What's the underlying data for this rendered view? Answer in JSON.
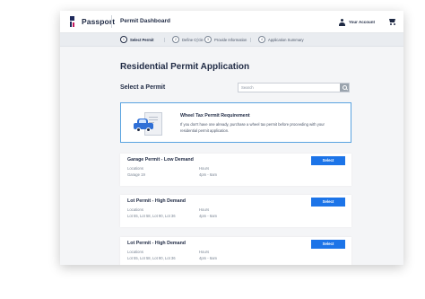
{
  "header": {
    "brand": "Passport",
    "title": "Permit Dashboard",
    "account_label": "Your Account"
  },
  "steps": [
    {
      "num": "1",
      "label": "Select Permit",
      "active": true
    },
    {
      "num": "2",
      "label": "Define Cycle",
      "active": false
    },
    {
      "num": "3",
      "label": "Provide Information",
      "active": false
    },
    {
      "num": "4",
      "label": "Application Summary",
      "active": false
    }
  ],
  "main": {
    "page_title": "Residential Permit Application",
    "section_title": "Select a Permit",
    "search_placeholder": "Search"
  },
  "info_box": {
    "title": "Wheel Tax Permit Requirement",
    "description": "If you don't have one already, purchase a wheel tax permit before proceeding with your residential permit application."
  },
  "permits": [
    {
      "title": "Garage Permit - Low Demand",
      "locations_label": "Locations",
      "locations": "Garage 19",
      "hours_label": "Hours",
      "hours": "4pm - 6am",
      "button": "Select"
    },
    {
      "title": "Lot Permit - High Demand",
      "locations_label": "Locations",
      "locations": "Lot 55, Lot 58, Lot 90, Lot 36",
      "hours_label": "Hours",
      "hours": "4pm - 6am",
      "button": "Select"
    },
    {
      "title": "Lot Permit - High Demand",
      "locations_label": "Locations",
      "locations": "Lot 55, Lot 58, Lot 90, Lot 36",
      "hours_label": "Hours",
      "hours": "4pm - 6am",
      "button": "Select"
    }
  ],
  "colors": {
    "accent": "#1c74e8",
    "navy": "#1f2a44",
    "info_border": "#5aa3e0",
    "brand_mark": "#c2185b"
  },
  "icons": [
    "passport-logo-icon",
    "user-icon",
    "cart-icon",
    "search-icon",
    "car-permit-icon"
  ]
}
